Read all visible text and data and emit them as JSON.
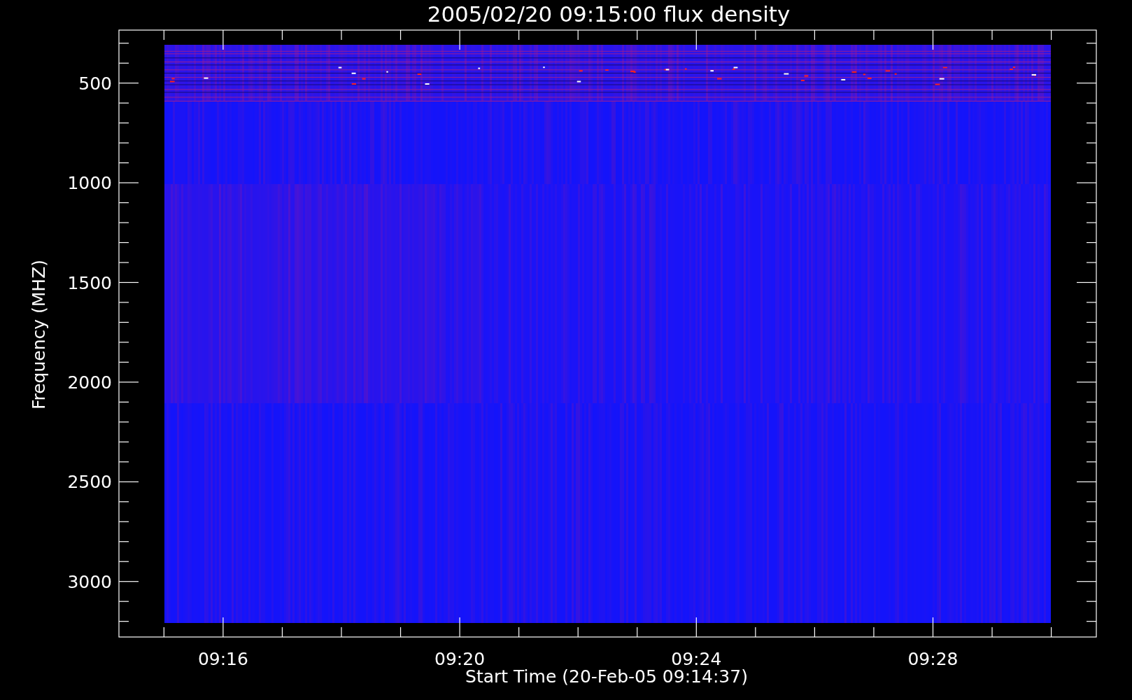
{
  "title": "2005/02/20 09:15:00 flux density",
  "y_axis": {
    "label": "Frequency (MHZ)",
    "ticks": [
      "500",
      "1000",
      "1500",
      "2000",
      "2500",
      "3000"
    ]
  },
  "x_axis": {
    "label": "Start Time (20-Feb-05 09:14:37)",
    "ticks": [
      "09:16",
      "09:20",
      "09:24",
      "09:28"
    ]
  }
}
